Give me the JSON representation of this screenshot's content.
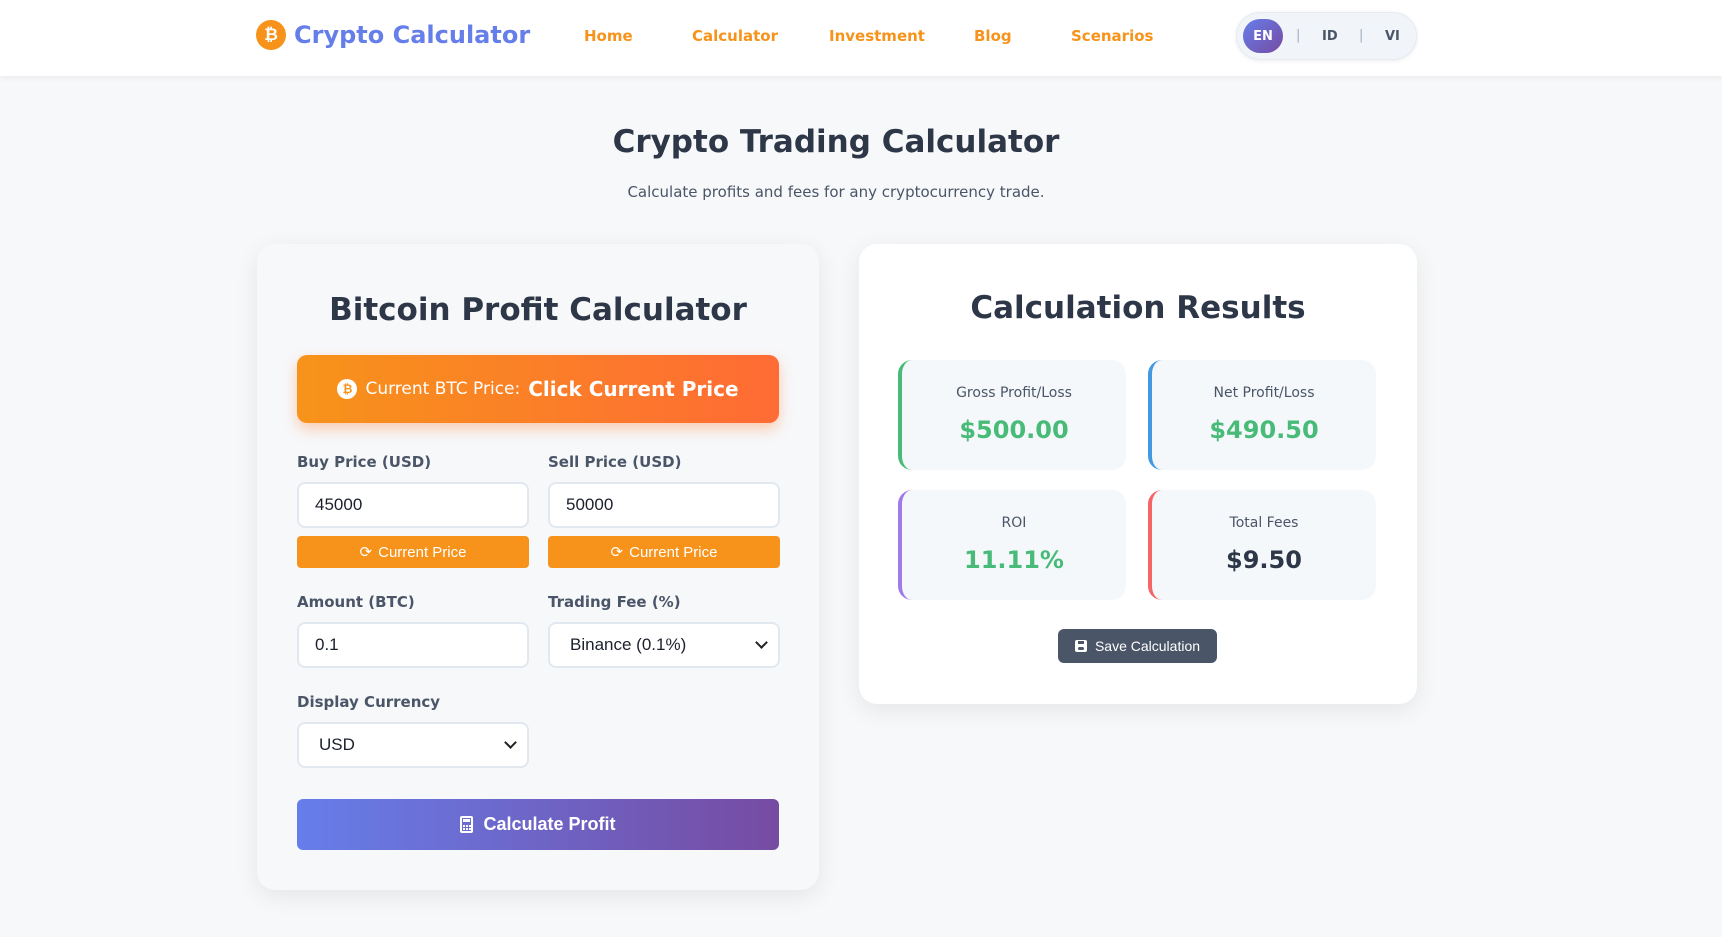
{
  "nav": {
    "brand": "Crypto Calculator",
    "brand_icon": "bitcoin-icon",
    "links": [
      "Home",
      "Calculator",
      "Investment",
      "Blog",
      "Scenarios"
    ],
    "languages": [
      "EN",
      "ID",
      "VI"
    ],
    "active_language": "EN",
    "separator": "|"
  },
  "header": {
    "title": "Crypto Trading Calculator",
    "subtitle": "Calculate profits and fees for any cryptocurrency trade."
  },
  "calculator": {
    "title": "Bitcoin Profit Calculator",
    "btc_price_label": "Current BTC Price:",
    "btc_price_value": "Click Current Price",
    "buy_price_label": "Buy Price (USD)",
    "buy_price_value": "45000",
    "sell_price_label": "Sell Price (USD)",
    "sell_price_value": "50000",
    "current_price_button": "Current Price",
    "amount_label": "Amount (BTC)",
    "amount_value": "0.1",
    "fee_label": "Trading Fee (%)",
    "fee_selected": "Binance (0.1%)",
    "currency_label": "Display Currency",
    "currency_selected": "USD",
    "calculate_button": "Calculate Profit"
  },
  "results": {
    "title": "Calculation Results",
    "gross_label": "Gross Profit/Loss",
    "gross_value": "$500.00",
    "net_label": "Net Profit/Loss",
    "net_value": "$490.50",
    "roi_label": "ROI",
    "roi_value": "11.11%",
    "fees_label": "Total Fees",
    "fees_value": "$9.50",
    "save_button": "Save Calculation"
  },
  "colors": {
    "accent_orange": "#f7931a",
    "brand_purple": "#667eea",
    "profit_green": "#48bb78",
    "net_blue": "#4299e1",
    "roi_purple": "#9f7aea",
    "fees_red": "#f56565"
  }
}
